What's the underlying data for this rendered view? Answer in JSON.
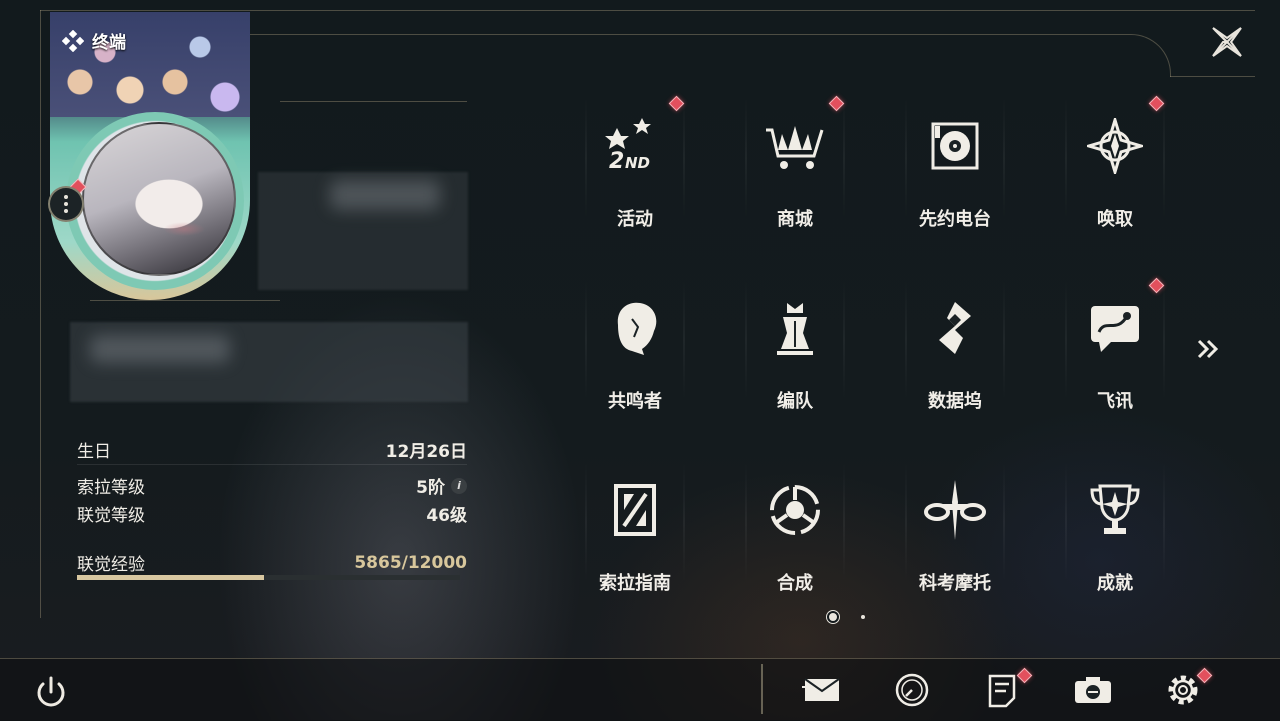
{
  "terminal": {
    "title": "终端"
  },
  "profile": {
    "birthday_label": "生日",
    "birthday_value": "12月26日",
    "sola_level_label": "索拉等级",
    "sola_level_value": "5阶",
    "info_icon": "i",
    "union_level_label": "联觉等级",
    "union_level_value": "46级",
    "union_xp_label": "联觉经验",
    "union_xp_value": "5865/12000",
    "union_xp_fraction": 0.489
  },
  "grid": {
    "items": [
      {
        "label": "活动",
        "icon": "event-icon",
        "badge": true
      },
      {
        "label": "商城",
        "icon": "shop-icon",
        "badge": true
      },
      {
        "label": "先约电台",
        "icon": "radio-icon",
        "badge": false
      },
      {
        "label": "唤取",
        "icon": "convene-icon",
        "badge": true
      },
      {
        "label": "共鸣者",
        "icon": "resonator-icon",
        "badge": false
      },
      {
        "label": "编队",
        "icon": "team-icon",
        "badge": false
      },
      {
        "label": "数据坞",
        "icon": "data-bank-icon",
        "badge": false
      },
      {
        "label": "飞讯",
        "icon": "message-icon",
        "badge": true
      },
      {
        "label": "索拉指南",
        "icon": "guidebook-icon",
        "badge": false
      },
      {
        "label": "合成",
        "icon": "synthesis-icon",
        "badge": false
      },
      {
        "label": "科考摩托",
        "icon": "motorbike-icon",
        "badge": false
      },
      {
        "label": "成就",
        "icon": "trophy-icon",
        "badge": false
      }
    ],
    "page_count": 2,
    "current_page": 1
  },
  "bottom": {
    "icons": [
      "power-icon",
      "mail-icon",
      "time-icon",
      "notice-icon",
      "camera-icon",
      "settings-icon"
    ]
  },
  "colors": {
    "accent_gold": "#d8c7a0",
    "badge_red": "#e2505d",
    "background": "#13191c"
  }
}
